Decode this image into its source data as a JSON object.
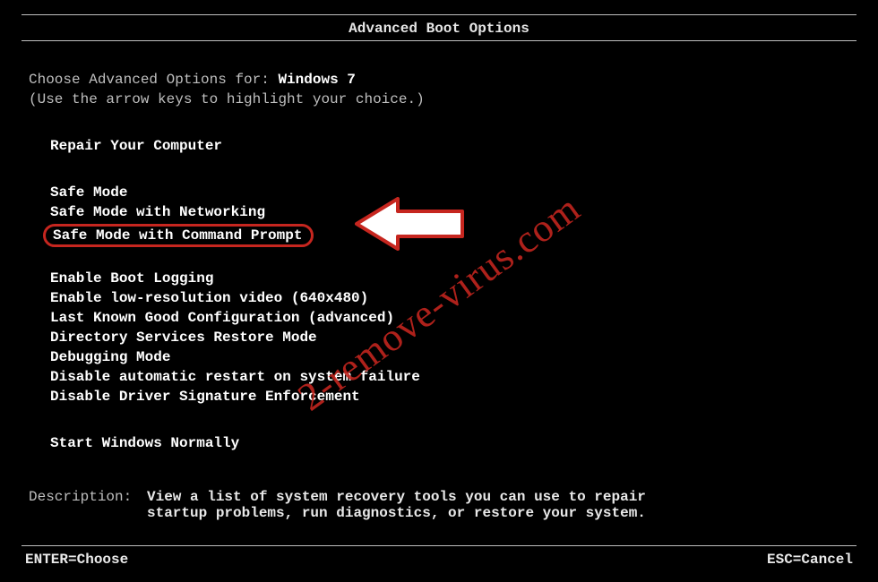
{
  "title": "Advanced Boot Options",
  "prompt_prefix": "Choose Advanced Options for: ",
  "os_name": "Windows 7",
  "hint": "(Use the arrow keys to highlight your choice.)",
  "group1": [
    "Repair Your Computer"
  ],
  "group2": [
    "Safe Mode",
    "Safe Mode with Networking"
  ],
  "circled_option": "Safe Mode with Command Prompt",
  "group3": [
    "Enable Boot Logging",
    "Enable low-resolution video (640x480)",
    "Last Known Good Configuration (advanced)",
    "Directory Services Restore Mode",
    "Debugging Mode",
    "Disable automatic restart on system failure",
    "Disable Driver Signature Enforcement"
  ],
  "group4": [
    "Start Windows Normally"
  ],
  "description_label": "Description:",
  "description_text": "View a list of system recovery tools you can use to repair startup problems, run diagnostics, or restore your system.",
  "footer_left": "ENTER=Choose",
  "footer_right": "ESC=Cancel",
  "watermark": "2-remove-virus.com"
}
